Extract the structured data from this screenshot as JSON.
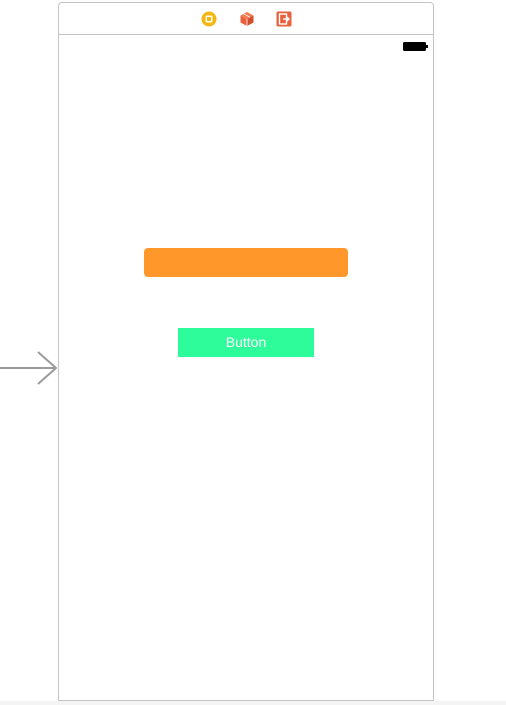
{
  "scene": {
    "dock": {
      "items": [
        {
          "icon": "view-controller-icon",
          "color": "#f5b70f"
        },
        {
          "icon": "first-responder-icon",
          "color": "#e8613c"
        },
        {
          "icon": "exit-icon",
          "color": "#e8613c"
        }
      ]
    },
    "status_bar": {
      "battery": "battery-icon"
    },
    "orange_view": {
      "color": "#ff972a"
    },
    "button": {
      "label": "Button",
      "background": "#2efb9a",
      "text_color": "#ffffff"
    }
  },
  "entry_arrow": "initial-view-controller-arrow-icon"
}
